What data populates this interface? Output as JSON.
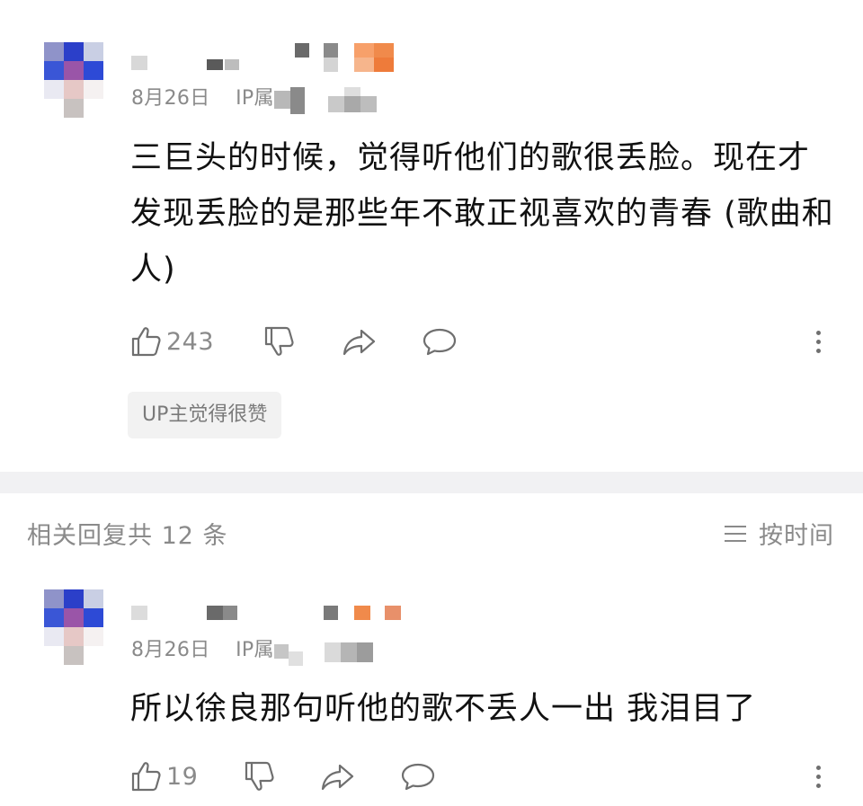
{
  "comments": [
    {
      "date": "8月26日",
      "ip_prefix": "IP属",
      "text": "三巨头的时候，觉得听他们的歌很丢脸。现在才发现丢脸的是那些年不敢正视喜欢的青春 (歌曲和人)",
      "like_count": "243",
      "badge": "UP主觉得很赞"
    },
    {
      "date": "8月26日",
      "ip_prefix": "IP属",
      "text": "所以徐良那句听他的歌不丢人一出 我泪目了",
      "like_count": "19"
    }
  ],
  "replies": {
    "title": "相关回复共 12 条",
    "sort_label": "按时间"
  },
  "icons": [
    "thumb-up-icon",
    "thumb-down-icon",
    "share-icon",
    "comment-icon",
    "more-vertical-icon",
    "sort-lines-icon"
  ],
  "colors": {
    "muted_text": "#8a8a8a",
    "body_text": "#111111",
    "divider": "#f1f1f3",
    "badge_bg": "#f2f2f2",
    "accent_orange": "#f08a4b"
  }
}
